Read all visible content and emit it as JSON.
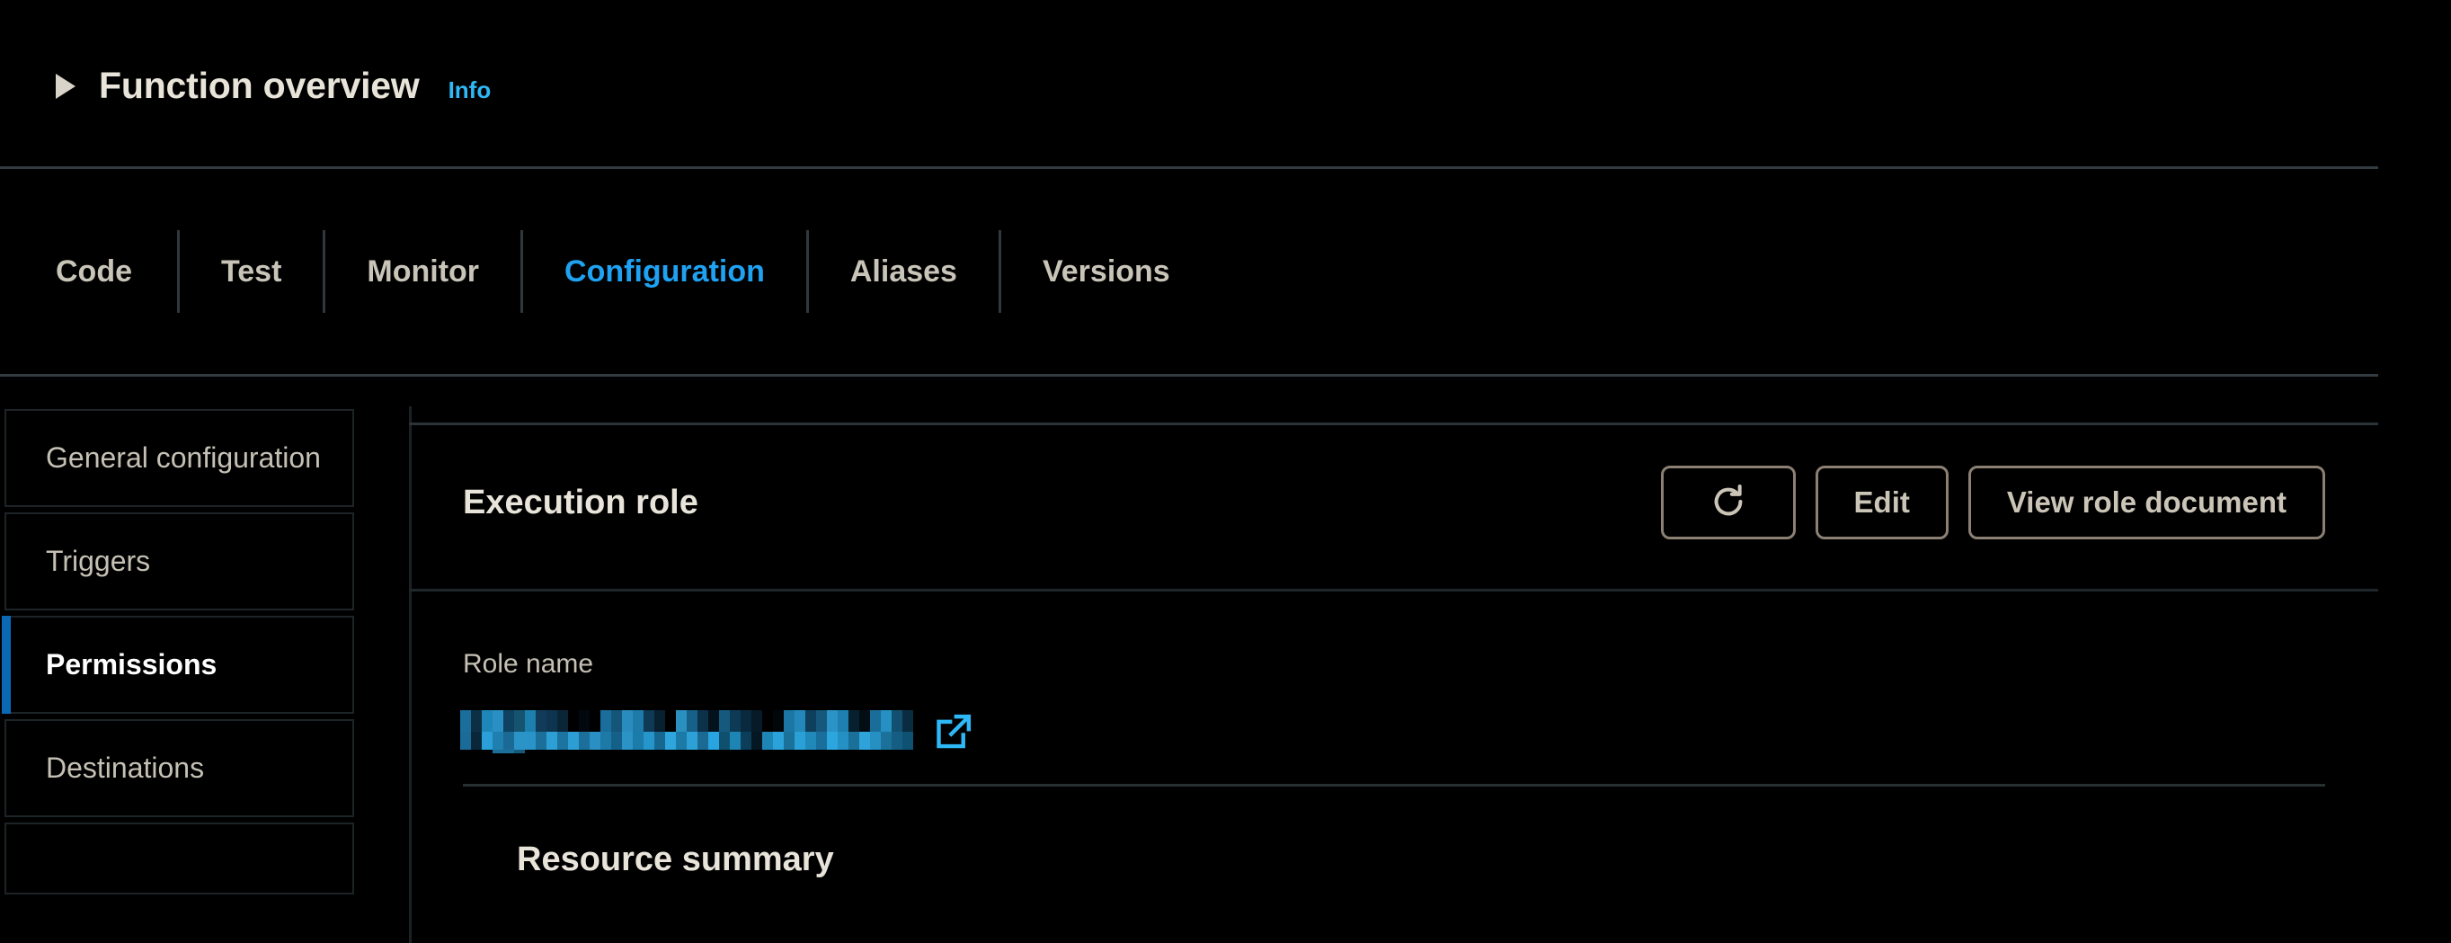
{
  "overview": {
    "title": "Function overview",
    "info_label": "Info",
    "expanded": false
  },
  "tabs": [
    {
      "label": "Code",
      "active": false
    },
    {
      "label": "Test",
      "active": false
    },
    {
      "label": "Monitor",
      "active": false
    },
    {
      "label": "Configuration",
      "active": true
    },
    {
      "label": "Aliases",
      "active": false
    },
    {
      "label": "Versions",
      "active": false
    }
  ],
  "sidenav": {
    "items": [
      {
        "label": "General configuration",
        "active": false
      },
      {
        "label": "Triggers",
        "active": false
      },
      {
        "label": "Permissions",
        "active": true
      },
      {
        "label": "Destinations",
        "active": false
      },
      {
        "label": "",
        "active": false,
        "partial": true
      }
    ]
  },
  "execution_role": {
    "title": "Execution role",
    "buttons": {
      "refresh_label": "",
      "refresh_icon": "refresh-icon",
      "edit_label": "Edit",
      "view_role_document_label": "View role document"
    },
    "role_name": {
      "label": "Role name",
      "value": "",
      "redacted": true,
      "link_icon": "external-link-icon"
    },
    "resource_summary_title": "Resource summary"
  },
  "colors": {
    "background": "#000000",
    "text": "#c5c0b4",
    "heading": "#e8e4da",
    "accent_link": "#2eb8f7",
    "accent_tab_active": "#1fa2f2",
    "accent_nav_active_bar": "#0a68b4",
    "button_border": "#8b8073",
    "divider": "#2a3338",
    "redaction_blue": "#1d7fb8"
  }
}
